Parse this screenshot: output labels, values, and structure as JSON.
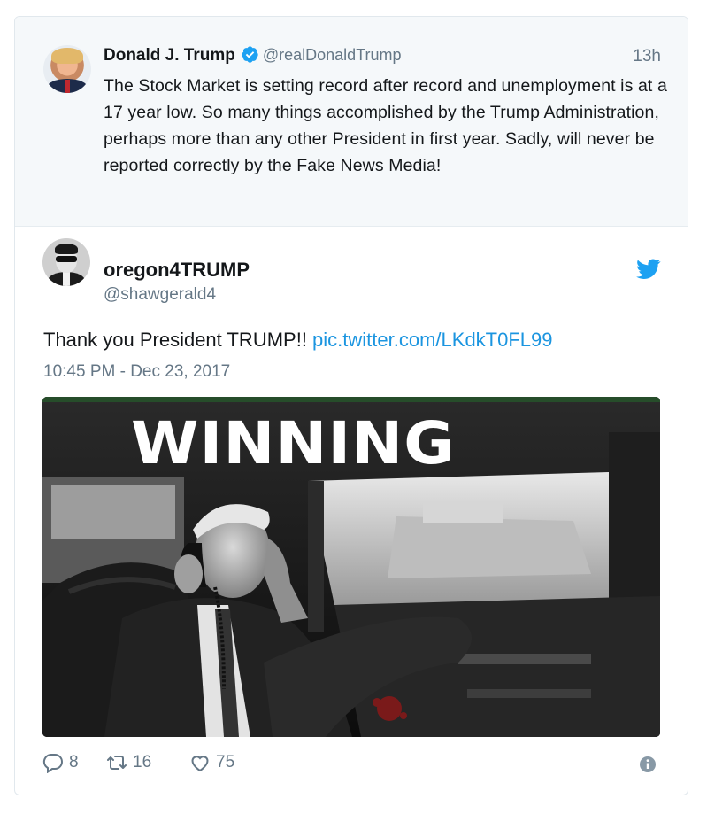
{
  "parent_tweet": {
    "author_name": "Donald J. Trump",
    "handle": "@realDonaldTrump",
    "time_ago": "13h",
    "text": "The Stock Market is setting record after record and unemployment is at a 17 year low. So many things accomplished by the Trump Administration, perhaps more than any other President in first year. Sadly, will never be reported correctly by the Fake News Media!",
    "avatar_icon": "user-avatar-photo",
    "verified_icon": "verified-badge-icon"
  },
  "main_tweet": {
    "author_name": "oregon4TRUMP",
    "handle": "@shawgerald4",
    "text": "Thank you President TRUMP!! ",
    "link_text": "pic.twitter.com/LKdkT0FL99",
    "timestamp": "10:45 PM - Dec 23, 2017",
    "brand_icon": "twitter-bird-icon",
    "media": {
      "caption": "WINNING",
      "image_description_icon": "photo-man-on-phone-in-limousine"
    }
  },
  "actions": {
    "reply_count": "8",
    "retweet_count": "16",
    "like_count": "75"
  },
  "colors": {
    "link": "#1b95e0",
    "secondary_text": "#657786",
    "primary_text": "#14171a",
    "parent_bg": "#f5f8fa",
    "border": "#e1e8ed"
  }
}
